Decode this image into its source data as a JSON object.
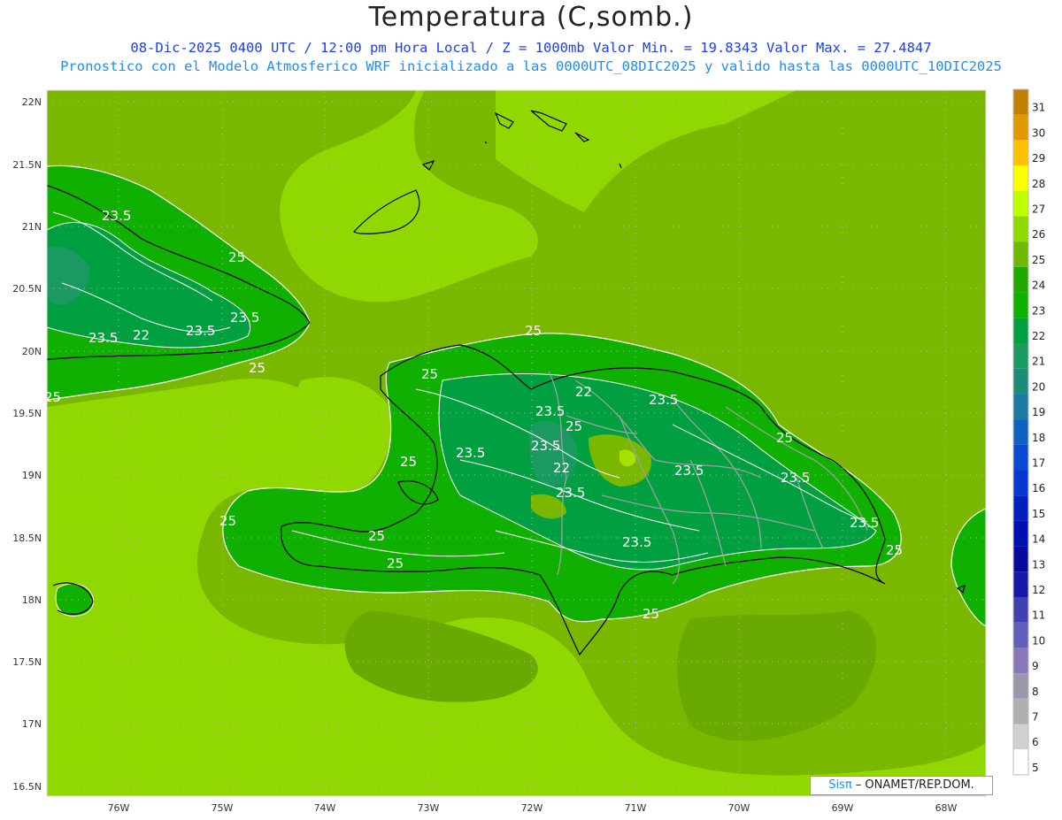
{
  "title": "Temperatura (C,somb.)",
  "subtitle_line1": "08-Dic-2025 0400 UTC / 12:00 pm Hora Local / Z = 1000mb  Valor Min. = 19.8343  Valor Max. = 27.4847",
  "subtitle_line2": "Pronostico con el Modelo Atmosferico WRF inicializado a las 0000UTC_08DIC2025 y valido hasta las  0000UTC_10DIC2025",
  "credit": {
    "brand": "Sisπ",
    "text": " – ONAMET/REP.DOM."
  },
  "lat_labels": [
    "22N",
    "21.5N",
    "21N",
    "20.5N",
    "20N",
    "19.5N",
    "19N",
    "18.5N",
    "18N",
    "17.5N",
    "17N",
    "16.5N"
  ],
  "lon_labels": [
    "76W",
    "75W",
    "74W",
    "73W",
    "72W",
    "71W",
    "70W",
    "69W",
    "68W"
  ],
  "contour_labels": [
    "23.5",
    "25",
    "23.5",
    "22",
    "23.5",
    "23.5",
    "25",
    "25",
    "25",
    "25",
    "22",
    "23.5",
    "23.5",
    "25",
    "23.5",
    "22",
    "23.5",
    "23.5",
    "23.5",
    "25",
    "23.5",
    "25",
    "23.5",
    "25",
    "25",
    "23.5",
    "25",
    "25",
    "25"
  ],
  "colorbar": {
    "labels": [
      "31",
      "30",
      "29",
      "28",
      "27",
      "26",
      "25",
      "24",
      "23",
      "22",
      "21",
      "20",
      "19",
      "18",
      "17",
      "16",
      "15",
      "14",
      "13",
      "12",
      "11",
      "10",
      "9",
      "8",
      "7",
      "6",
      "5"
    ],
    "colors": [
      "#c08000",
      "#e09a00",
      "#ffc000",
      "#ffff00",
      "#c0ff00",
      "#90d800",
      "#70b800",
      "#20a800",
      "#10b000",
      "#00a040",
      "#1a9a60",
      "#208a7a",
      "#1a7aa0",
      "#1060c0",
      "#0a48d0",
      "#0838d0",
      "#0020c0",
      "#0010b0",
      "#0808a0",
      "#1818a8",
      "#4040b0",
      "#6060b8",
      "#8878b8",
      "#9898a8",
      "#b0b0b0",
      "#d0d0d0",
      "#ffffff"
    ]
  },
  "colors": {
    "land_main": "#7ab800",
    "sea_light": "#90d800",
    "warm_land": "#10b000",
    "cool_land": "#00a040"
  }
}
